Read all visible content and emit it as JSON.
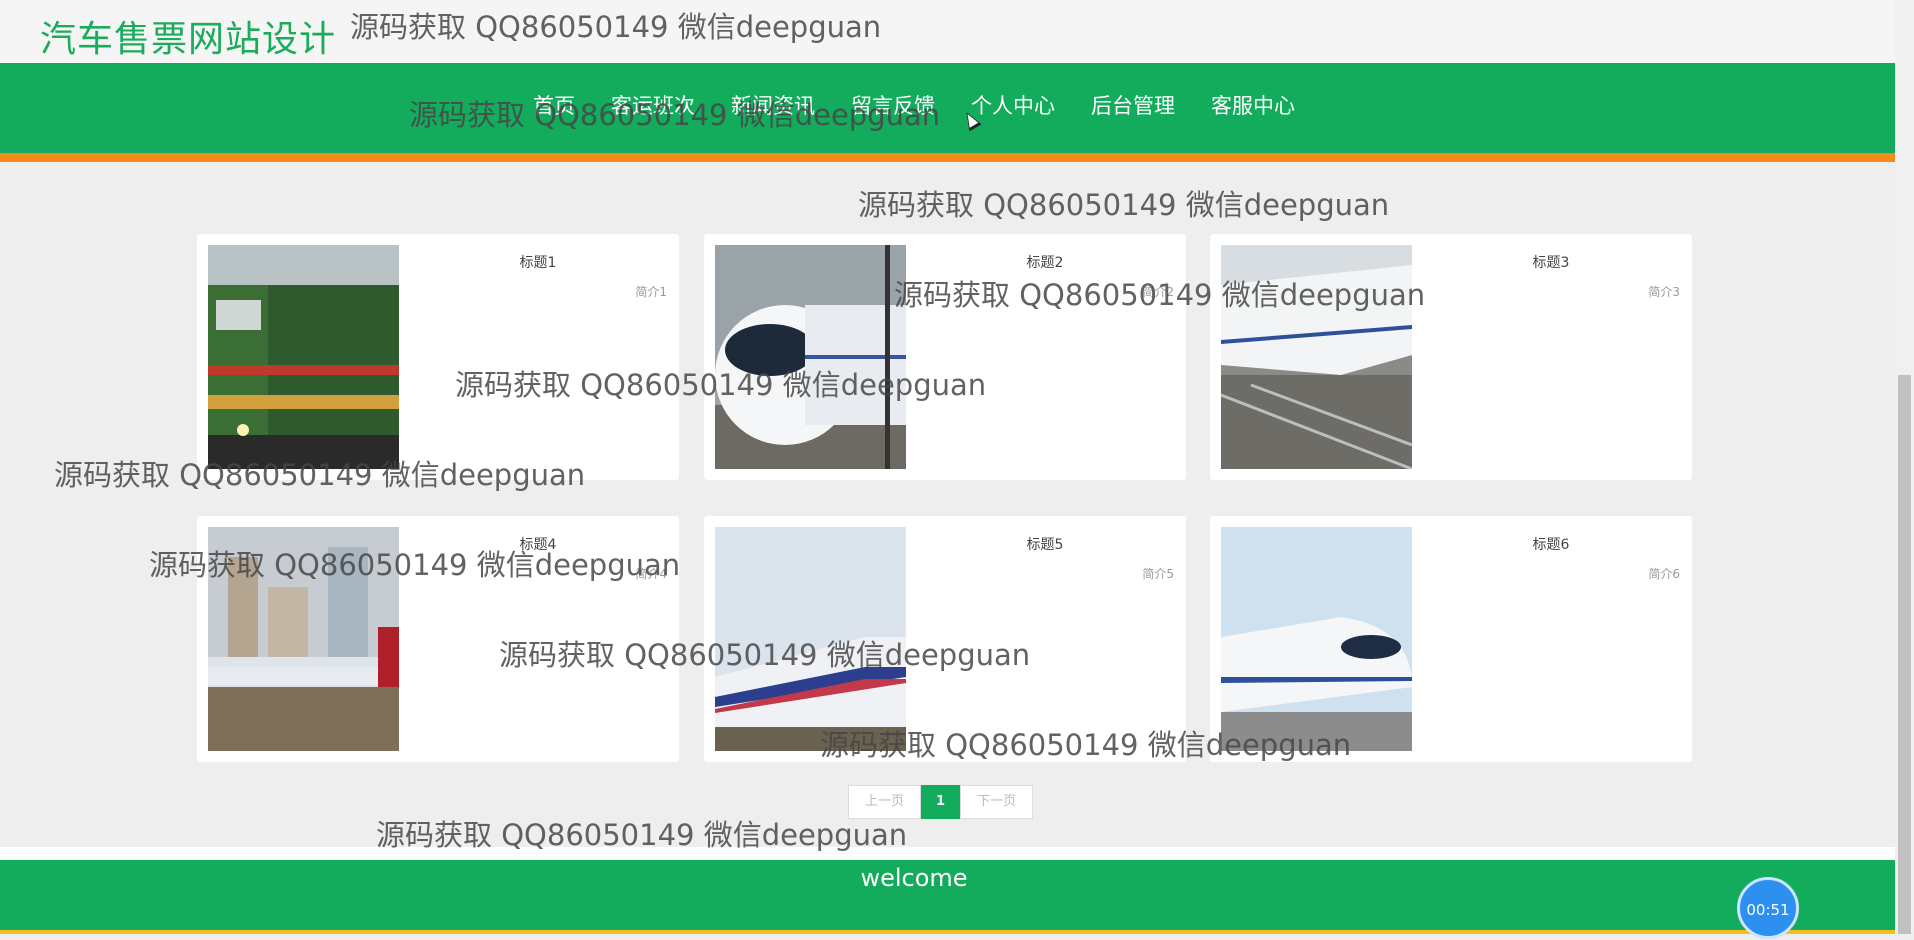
{
  "site": {
    "title": "汽车售票网站设计"
  },
  "nav": {
    "items": [
      "首页",
      "客运班次",
      "新闻资讯",
      "留言反馈",
      "个人中心",
      "后台管理",
      "客服中心"
    ]
  },
  "cards": [
    {
      "title": "标题1",
      "desc": "简介1",
      "image": "green-locomotive"
    },
    {
      "title": "标题2",
      "desc": "简介2",
      "image": "white-bullet-train-front"
    },
    {
      "title": "标题3",
      "desc": "简介3",
      "image": "white-high-speed-train"
    },
    {
      "title": "标题4",
      "desc": "简介4",
      "image": "train-city-skyline"
    },
    {
      "title": "标题5",
      "desc": "简介5",
      "image": "blue-stripe-train"
    },
    {
      "title": "标题6",
      "desc": "简介6",
      "image": "crh-train"
    }
  ],
  "pager": {
    "prev": "上一页",
    "current": "1",
    "next": "下一页"
  },
  "footer": {
    "text": "welcome"
  },
  "timer": {
    "label": "00:51"
  },
  "watermark": {
    "text": "源码获取 QQ86050149 微信deepguan"
  },
  "colors": {
    "brand_green": "#13ab5c",
    "accent_orange": "#f48c1a"
  }
}
